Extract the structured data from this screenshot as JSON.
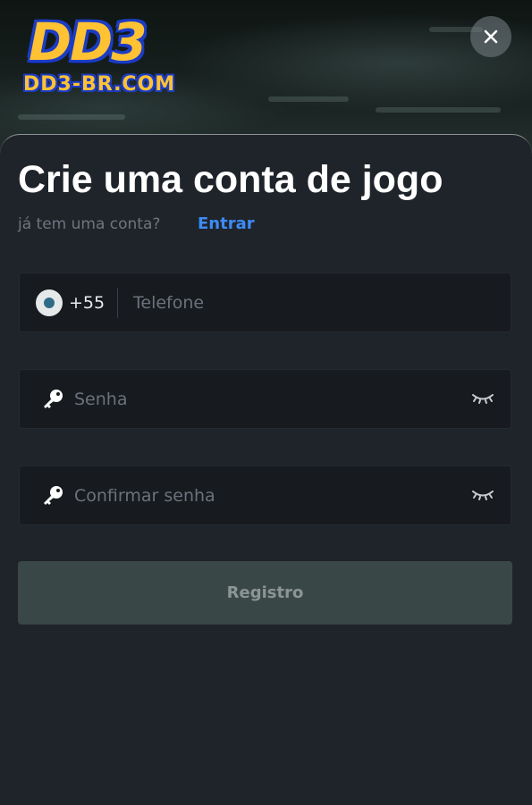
{
  "brand": {
    "logo_top": "DD3",
    "logo_bottom": "DD3-BR.COM"
  },
  "header": {
    "close_icon": "close-icon"
  },
  "form": {
    "title": "Crie uma conta de jogo",
    "subtitle": "já tem uma conta?",
    "login_link": "Entrar",
    "phone": {
      "country_code": "+55",
      "placeholder": "Telefone",
      "value": ""
    },
    "password": {
      "placeholder": "Senha",
      "value": ""
    },
    "confirm_password": {
      "placeholder": "Confirmar senha",
      "value": ""
    },
    "submit_label": "Registro"
  },
  "colors": {
    "accent": "#3d8bf5",
    "logo": "#ffc233",
    "background": "#1f242b"
  }
}
